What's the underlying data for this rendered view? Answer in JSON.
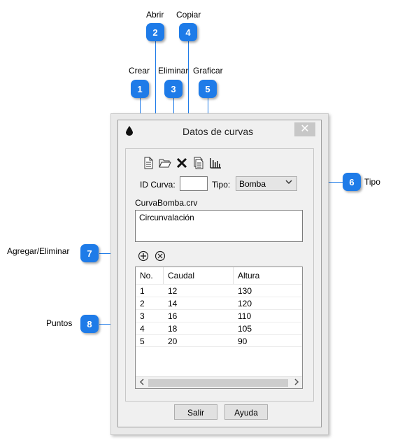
{
  "annotations": [
    {
      "num": "1",
      "label": "Crear"
    },
    {
      "num": "2",
      "label": "Abrir"
    },
    {
      "num": "3",
      "label": "Eliminar"
    },
    {
      "num": "4",
      "label": "Copiar"
    },
    {
      "num": "5",
      "label": "Graficar"
    },
    {
      "num": "6",
      "label": "Tipo"
    },
    {
      "num": "7",
      "label": "Agregar/Eliminar"
    },
    {
      "num": "8",
      "label": "Puntos"
    }
  ],
  "dialog": {
    "title": "Datos de curvas",
    "close_glyph": "✕",
    "id_label": "ID Curva:",
    "id_value": "",
    "type_label": "Tipo:",
    "type_value": "Bomba",
    "filename": "CurvaBomba.crv",
    "description": "Circunvalación",
    "table": {
      "columns": [
        "No.",
        "Caudal",
        "Altura"
      ],
      "rows": [
        [
          "1",
          "12",
          "130"
        ],
        [
          "2",
          "14",
          "120"
        ],
        [
          "3",
          "16",
          "110"
        ],
        [
          "4",
          "18",
          "105"
        ],
        [
          "5",
          "20",
          "90"
        ]
      ]
    },
    "exit_label": "Salir",
    "help_label": "Ayuda"
  },
  "icons": [
    "drop-icon",
    "new-file-icon",
    "open-folder-icon",
    "delete-icon",
    "copy-icon",
    "bar-chart-icon",
    "add-circle-icon",
    "remove-circle-icon"
  ],
  "colors": {
    "callout": "#1e7be8"
  }
}
